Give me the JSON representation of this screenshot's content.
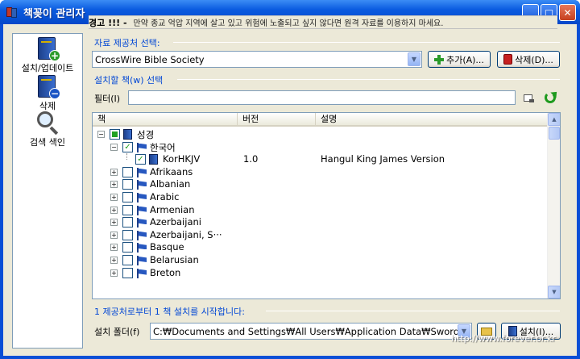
{
  "window": {
    "title": "책꽂이 관리자",
    "min": "_",
    "max": "□",
    "close": "✕"
  },
  "sidebar": {
    "items": [
      {
        "label": "설치/업데이트",
        "icon": "book-add-icon"
      },
      {
        "label": "삭제",
        "icon": "book-remove-icon"
      },
      {
        "label": "검색 색인",
        "icon": "magnifier-icon"
      }
    ]
  },
  "warning": {
    "title": "경고 !!!  -",
    "text": "만약 종교 억압 지역에 살고 있고 위험에 노출되고 싶지 않다면 원격 자료를 이용하지 마세요."
  },
  "source": {
    "group_label": "자료 제공처 선택:",
    "selected": "CrossWire Bible Society",
    "add_label": "추가(A)...",
    "delete_label": "삭제(D)..."
  },
  "books": {
    "group_label": "설치할 책(w) 선택",
    "filter_label": "필터(I)",
    "filter_value": "",
    "columns": [
      "책",
      "버전",
      "설명"
    ],
    "rows": [
      {
        "name": "성경",
        "level": 0,
        "expander": "−",
        "check": "partial",
        "icon": "bible-icon",
        "version": "",
        "desc": ""
      },
      {
        "name": "한국어",
        "level": 1,
        "expander": "−",
        "check": "checked",
        "icon": "flag-icon",
        "version": "",
        "desc": ""
      },
      {
        "name": "KorHKJV",
        "level": 2,
        "expander": "",
        "check": "checked",
        "icon": "bible-icon",
        "version": "1.0",
        "desc": "Hangul King James Version"
      },
      {
        "name": "Afrikaans",
        "level": 1,
        "expander": "+",
        "check": "none",
        "icon": "flag-icon",
        "version": "",
        "desc": ""
      },
      {
        "name": "Albanian",
        "level": 1,
        "expander": "+",
        "check": "none",
        "icon": "flag-icon",
        "version": "",
        "desc": ""
      },
      {
        "name": "Arabic",
        "level": 1,
        "expander": "+",
        "check": "none",
        "icon": "flag-icon",
        "version": "",
        "desc": ""
      },
      {
        "name": "Armenian",
        "level": 1,
        "expander": "+",
        "check": "none",
        "icon": "flag-icon",
        "version": "",
        "desc": ""
      },
      {
        "name": "Azerbaijani",
        "level": 1,
        "expander": "+",
        "check": "none",
        "icon": "flag-icon",
        "version": "",
        "desc": ""
      },
      {
        "name": "Azerbaijani, S···",
        "level": 1,
        "expander": "+",
        "check": "none",
        "icon": "flag-icon",
        "version": "",
        "desc": ""
      },
      {
        "name": "Basque",
        "level": 1,
        "expander": "+",
        "check": "none",
        "icon": "flag-icon",
        "version": "",
        "desc": ""
      },
      {
        "name": "Belarusian",
        "level": 1,
        "expander": "+",
        "check": "none",
        "icon": "flag-icon",
        "version": "",
        "desc": ""
      },
      {
        "name": "Breton",
        "level": 1,
        "expander": "+",
        "check": "none",
        "icon": "flag-icon",
        "version": "",
        "desc": ""
      }
    ]
  },
  "status": "1 제공처로부터 1 책 설치를 시작합니다:",
  "install": {
    "folder_label": "설치 폴더(f)",
    "folder_value": "C:₩Documents and Settings₩All Users₩Application Data₩Sword",
    "install_label": "설치(I)..."
  },
  "watermark": "http://www.forever.or.kr"
}
